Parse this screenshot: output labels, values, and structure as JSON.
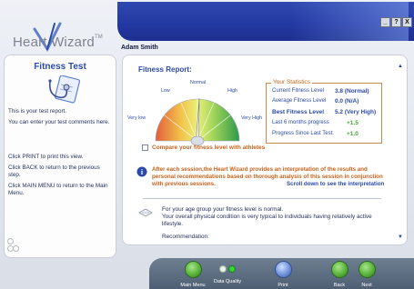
{
  "header": {
    "logo_word1": "Heart",
    "logo_word2": "Wizard",
    "logo_tm": "TM",
    "user_name": "Adam Smith",
    "window_controls": [
      "_",
      "?",
      "X"
    ]
  },
  "left_panel": {
    "title": "Fitness Test",
    "icon": "stethoscope-clipboard-icon",
    "paragraphs": [
      "This is your test report.",
      "You can enter your test comments here.",
      "Click PRINT to print this view.",
      "Click BACK to return to the previous step.",
      "Click MAIN MENU to return to the Main Menu."
    ]
  },
  "report": {
    "title": "Fitness Report:",
    "gauge_labels": {
      "very_low": "Very low",
      "low": "Low",
      "normal": "Normal",
      "high": "High",
      "very_high": "Very High"
    },
    "needle_level": "Normal",
    "stats": {
      "title": "Your Statistics",
      "rows": [
        {
          "label": "Current Fitness Level",
          "value": "3.8 (Normal)",
          "style": "bold"
        },
        {
          "label": "Average Fitness Level",
          "value": "0.0 (N/A)",
          "style": "bold"
        },
        {
          "label": "Best Fitness Level",
          "value": "5.2 (Very High)",
          "style": "bold"
        },
        {
          "label": "Last 6 months progress",
          "value": "+1.5",
          "style": "green"
        },
        {
          "label": "Progress Since Last Test:",
          "value": "+1.0",
          "style": "green"
        }
      ]
    },
    "compare_label": "Compare your fitness level with athletes",
    "compare_checked": false,
    "info_text": "After each session,the Heart Wizard provides an interpretation of the results and personal recommendations based on thorough analysis of this session in conjunction with previous sessions.",
    "scroll_hint": "Scroll down to see the interpretation",
    "interpretation": [
      "For your age group your fitness level is normal.",
      "Your overall physical condition is very typical to individuals having relatively active lifestyle.",
      "Recommendation:"
    ]
  },
  "footer": {
    "buttons": [
      {
        "label": "Main Menu",
        "icon": "refresh-icon"
      },
      {
        "label": "Data Quality",
        "icon": "status-lights-icon"
      },
      {
        "label": "Print",
        "icon": "print-icon"
      },
      {
        "label": "Back",
        "icon": "arrow-left-icon"
      },
      {
        "label": "Next",
        "icon": "arrow-right-icon"
      }
    ]
  },
  "colors": {
    "banner": "#2339a3",
    "title_blue": "#2b4aa8",
    "accent_orange": "#c9621a",
    "positive_green": "#41a52e",
    "footer_gray": "#5b6a7e"
  }
}
